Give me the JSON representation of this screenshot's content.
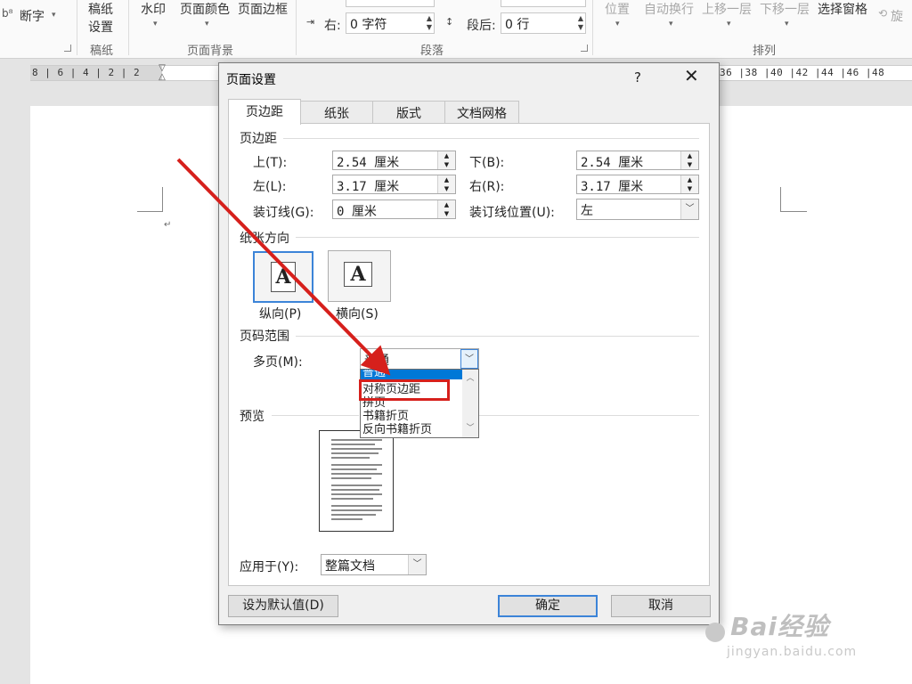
{
  "ribbon": {
    "hyphenation": "断字",
    "manuscript_line1": "稿纸",
    "manuscript_line2": "设置",
    "manuscript_group": "稿纸",
    "watermark": "水印",
    "page_color": "页面颜色",
    "page_border": "页面边框",
    "page_bg_group": "页面背景",
    "indent_right_label": "右:",
    "indent_right_value": "0 字符",
    "spacing_after_label": "段后:",
    "spacing_after_value": "0 行",
    "paragraph_group": "段落",
    "position": "位置",
    "wrap_text": "自动换行",
    "bring_forward": "上移一层",
    "send_backward": "下移一层",
    "selection_pane": "选择窗格",
    "rotate": "旋",
    "arrange_group": "排列"
  },
  "ruler": {
    "left": "8 | 6 | 4 | 2 | 2",
    "right": "36 |38 |40 |42 |44 |46 |48"
  },
  "dialog": {
    "title": "页面设置",
    "help": "?",
    "close": "✕",
    "tabs": [
      "页边距",
      "纸张",
      "版式",
      "文档网格"
    ],
    "margins_section": "页边距",
    "top_label": "上(T):",
    "top_value": "2.54 厘米",
    "bottom_label": "下(B):",
    "bottom_value": "2.54 厘米",
    "left_label": "左(L):",
    "left_value": "3.17 厘米",
    "right_label": "右(R):",
    "right_value": "3.17 厘米",
    "gutter_label": "装订线(G):",
    "gutter_value": "0 厘米",
    "gutter_pos_label": "装订线位置(U):",
    "gutter_pos_value": "左",
    "orientation_section": "纸张方向",
    "portrait": "纵向(P)",
    "landscape": "横向(S)",
    "orientation_glyph": "A",
    "pages_section": "页码范围",
    "multiple_pages_label": "多页(M):",
    "multiple_pages_value": "普通",
    "multiple_pages_options": [
      "普通",
      "对称页边距",
      "拼页",
      "书籍折页",
      "反向书籍折页"
    ],
    "preview_section": "预览",
    "apply_to_label": "应用于(Y):",
    "apply_to_value": "整篇文档",
    "set_default": "设为默认值(D)",
    "ok": "确定",
    "cancel": "取消"
  },
  "watermark": {
    "brand": "Bai经验",
    "url": "jingyan.baidu.com"
  },
  "colors": {
    "highlight": "#0078d7",
    "annotation_red": "#d6201c"
  }
}
